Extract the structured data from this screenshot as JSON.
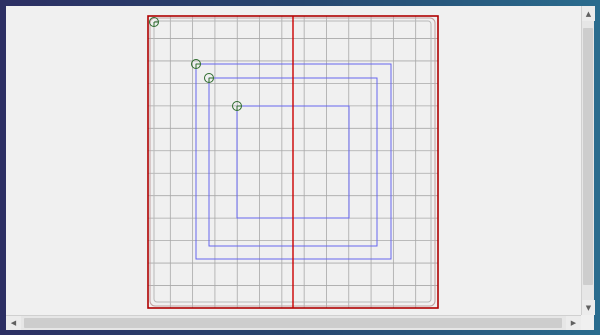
{
  "app": {
    "canvas": {
      "background": "#f0f0f0",
      "grid_color": "#a8a8a8",
      "border_color": "#b00000",
      "path_color": "#6666ee",
      "marker_color": "#2e6b2e",
      "grid_columns": 13,
      "grid_rows": 13,
      "paths": [
        "outer-path",
        "path-1",
        "path-2",
        "path-3"
      ]
    },
    "scrollbars": {
      "up_glyph": "▲",
      "down_glyph": "▼",
      "left_glyph": "◀",
      "right_glyph": "▶"
    }
  }
}
